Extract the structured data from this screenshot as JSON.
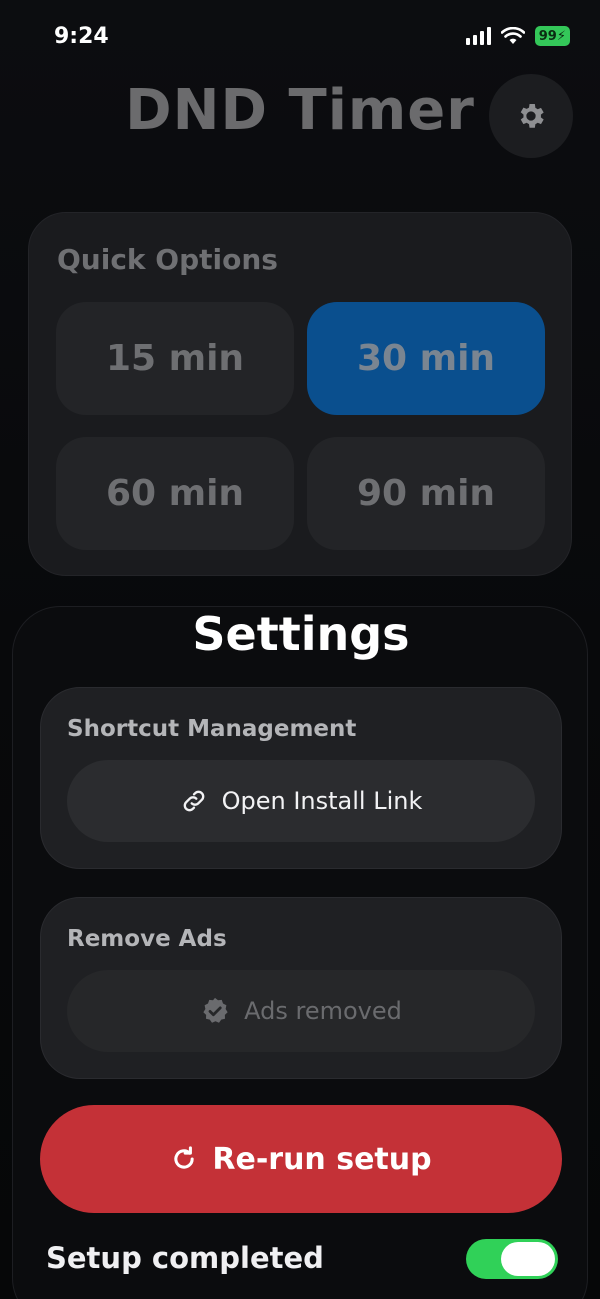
{
  "status_bar": {
    "time": "9:24",
    "battery": "99"
  },
  "header": {
    "title": "DND Timer"
  },
  "quick_options": {
    "title": "Quick Options",
    "options": [
      {
        "label": "15 min",
        "selected": false
      },
      {
        "label": "30 min",
        "selected": true
      },
      {
        "label": "60 min",
        "selected": false
      },
      {
        "label": "90 min",
        "selected": false
      }
    ]
  },
  "settings": {
    "title": "Settings",
    "shortcut_management": {
      "title": "Shortcut Management",
      "button_label": "Open Install Link"
    },
    "remove_ads": {
      "title": "Remove Ads",
      "button_label": "Ads removed"
    },
    "rerun_label": "Re-run setup",
    "setup_completed": {
      "label": "Setup completed",
      "on": true
    }
  },
  "colors": {
    "accent_selected": "#0a4f8e",
    "danger": "#c43137",
    "toggle_on": "#30d158",
    "battery": "#34c759"
  },
  "icons": [
    "signal-icon",
    "wifi-icon",
    "battery-icon",
    "gear-icon",
    "link-icon",
    "verified-badge-icon",
    "refresh-icon"
  ]
}
